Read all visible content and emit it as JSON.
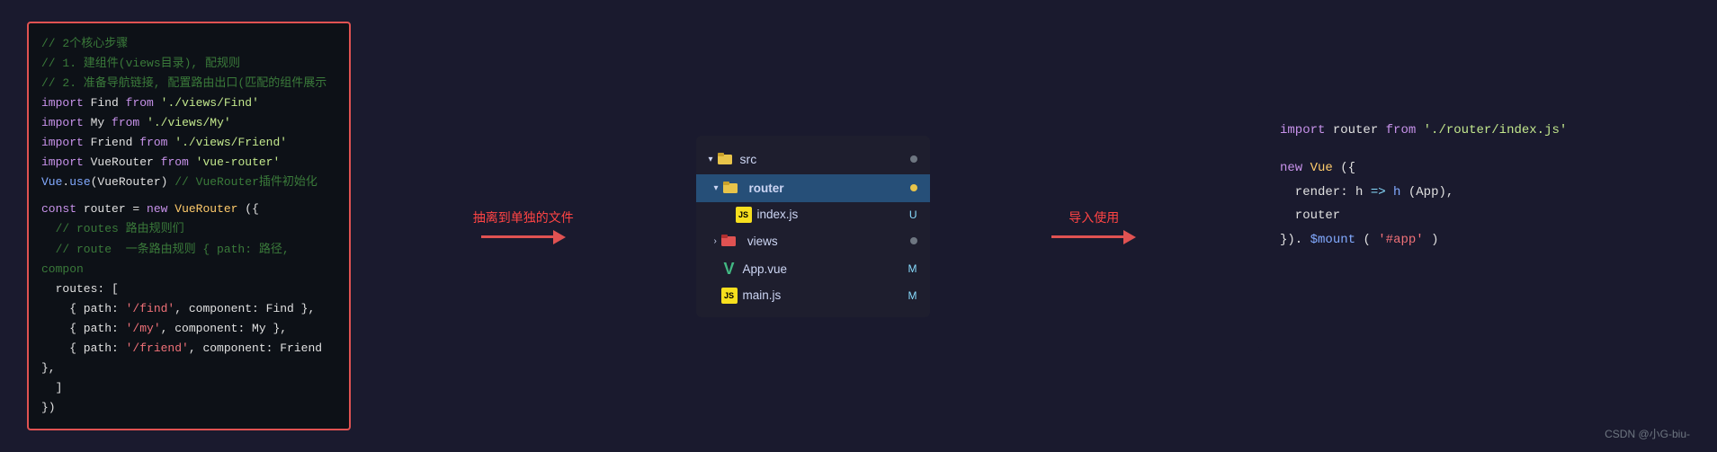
{
  "left_panel": {
    "lines": [
      {
        "type": "comment",
        "text": "// 2个核心步骤"
      },
      {
        "type": "comment",
        "text": "// 1. 建组件(views目录), 配规则"
      },
      {
        "type": "comment",
        "text": "// 2. 准备导航链接, 配置路由出口(匹配的组件展示"
      },
      {
        "type": "code",
        "parts": [
          {
            "cls": "code-keyword",
            "t": "import"
          },
          {
            "cls": "code-white",
            "t": " Find "
          },
          {
            "cls": "code-keyword",
            "t": "from"
          },
          {
            "cls": "code-import-path",
            "t": " './views/Find'"
          }
        ]
      },
      {
        "type": "code",
        "parts": [
          {
            "cls": "code-keyword",
            "t": "import"
          },
          {
            "cls": "code-white",
            "t": " My "
          },
          {
            "cls": "code-keyword",
            "t": "from"
          },
          {
            "cls": "code-import-path",
            "t": " './views/My'"
          }
        ]
      },
      {
        "type": "code",
        "parts": [
          {
            "cls": "code-keyword",
            "t": "import"
          },
          {
            "cls": "code-white",
            "t": " Friend "
          },
          {
            "cls": "code-keyword",
            "t": "from"
          },
          {
            "cls": "code-import-path",
            "t": " './views/Friend'"
          }
        ]
      },
      {
        "type": "code",
        "parts": [
          {
            "cls": "code-keyword",
            "t": "import"
          },
          {
            "cls": "code-white",
            "t": " VueRouter "
          },
          {
            "cls": "code-keyword",
            "t": "from"
          },
          {
            "cls": "code-import-path",
            "t": " 'vue-router'"
          }
        ]
      },
      {
        "type": "code",
        "parts": [
          {
            "cls": "code-blue",
            "t": "Vue"
          },
          {
            "cls": "code-white",
            "t": "."
          },
          {
            "cls": "code-func",
            "t": "use"
          },
          {
            "cls": "code-white",
            "t": "(VueRouter) "
          },
          {
            "cls": "code-comment",
            "t": "// VueRouter插件初始化"
          }
        ]
      },
      {
        "type": "empty"
      },
      {
        "type": "code",
        "parts": [
          {
            "cls": "code-keyword",
            "t": "const"
          },
          {
            "cls": "code-white",
            "t": " router = "
          },
          {
            "cls": "code-keyword",
            "t": "new"
          },
          {
            "cls": "code-yellow",
            "t": " VueRouter"
          },
          {
            "cls": "code-white",
            "t": "({"
          }
        ]
      },
      {
        "type": "code",
        "parts": [
          {
            "cls": "code-comment",
            "t": "  // routes 路由规则们"
          }
        ]
      },
      {
        "type": "code",
        "parts": [
          {
            "cls": "code-comment",
            "t": "  // route  一条路由规则 { path: 路径, compon"
          }
        ]
      },
      {
        "type": "code",
        "parts": [
          {
            "cls": "code-white",
            "t": "  routes: ["
          }
        ]
      },
      {
        "type": "code",
        "parts": [
          {
            "cls": "code-white",
            "t": "    { path: "
          },
          {
            "cls": "code-string",
            "t": "'/find'"
          },
          {
            "cls": "code-white",
            "t": ", component: Find },"
          }
        ]
      },
      {
        "type": "code",
        "parts": [
          {
            "cls": "code-white",
            "t": "    { path: "
          },
          {
            "cls": "code-string",
            "t": "'/my'"
          },
          {
            "cls": "code-white",
            "t": ", component: My },"
          }
        ]
      },
      {
        "type": "code",
        "parts": [
          {
            "cls": "code-white",
            "t": "    { path: "
          },
          {
            "cls": "code-string",
            "t": "'/friend'"
          },
          {
            "cls": "code-white",
            "t": ", component: Friend },"
          }
        ]
      },
      {
        "type": "code",
        "parts": [
          {
            "cls": "code-white",
            "t": "  ]"
          }
        ]
      },
      {
        "type": "code",
        "parts": [
          {
            "cls": "code-white",
            "t": "})"
          }
        ]
      }
    ]
  },
  "middle_panel": {
    "src_label": "src",
    "router_label": "router",
    "index_label": "index.js",
    "index_badge": "U",
    "views_label": "views",
    "appvue_label": "App.vue",
    "appvue_badge": "M",
    "mainjs_label": "main.js",
    "mainjs_badge": "M"
  },
  "arrows": {
    "left_label": "抽离到单独的文件",
    "right_label": "导入使用"
  },
  "right_panel": {
    "line1_parts": [
      {
        "cls": "code-keyword",
        "t": "import"
      },
      {
        "cls": "code-white",
        "t": " router "
      },
      {
        "cls": "code-keyword",
        "t": "from"
      },
      {
        "cls": "code-import-path",
        "t": " './router/index.js'"
      }
    ],
    "line2": "",
    "line3_parts": [
      {
        "cls": "code-keyword",
        "t": "new"
      },
      {
        "cls": "code-yellow",
        "t": " Vue"
      },
      {
        "cls": "code-white",
        "t": "({"
      }
    ],
    "line4_parts": [
      {
        "cls": "code-white",
        "t": "  render: h "
      },
      {
        "cls": "code-cyan",
        "t": "=>"
      },
      {
        "cls": "code-white",
        "t": " "
      },
      {
        "cls": "code-func",
        "t": "h"
      },
      {
        "cls": "code-white",
        "t": "(App),"
      }
    ],
    "line5_parts": [
      {
        "cls": "code-white",
        "t": "  router"
      }
    ],
    "line6_parts": [
      {
        "cls": "code-white",
        "t": "})."
      },
      {
        "cls": "code-func",
        "t": "$mount"
      },
      {
        "cls": "code-white",
        "t": "("
      },
      {
        "cls": "code-string",
        "t": "'#app'"
      },
      {
        "cls": "code-white",
        "t": ")"
      }
    ]
  },
  "watermark": "CSDN @小G-biu-"
}
